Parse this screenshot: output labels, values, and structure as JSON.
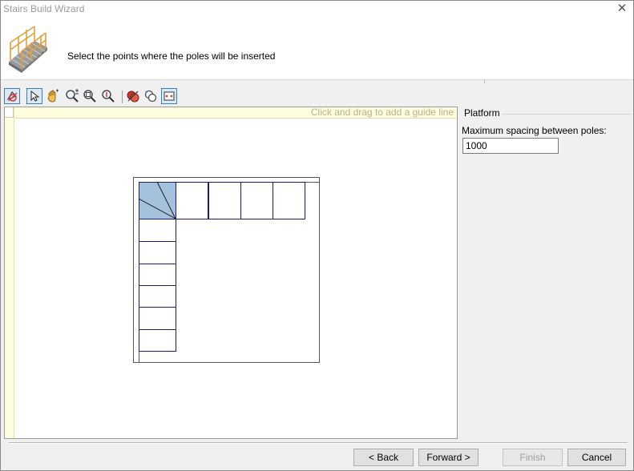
{
  "window": {
    "title": "Stairs Build Wizard",
    "close_symbol": "✕"
  },
  "header": {
    "instruction": "Select the points where the poles will be inserted",
    "logo_icon": "stairs-logo-icon"
  },
  "toolbar": {
    "tools": [
      {
        "name": "shape-select-icon",
        "active": true
      },
      {
        "name": "pointer-icon",
        "active": true
      },
      {
        "name": "pan-hand-icon",
        "active": false
      },
      {
        "name": "zoom-plus-minus-icon",
        "active": false
      },
      {
        "name": "zoom-window-icon",
        "active": false
      },
      {
        "name": "zoom-extents-icon",
        "active": false
      },
      {
        "name": "remove-poles-icon",
        "active": false
      },
      {
        "name": "circles-icon",
        "active": false
      },
      {
        "name": "fit-to-view-icon",
        "active": true
      }
    ]
  },
  "canvas": {
    "guide_hint": "Click and drag to add a guide line",
    "colors": {
      "outline": "#545454",
      "steps": "#1f1d6b",
      "landing_fill": "#a5c2dd"
    }
  },
  "panel": {
    "group_title": "Platform",
    "spacing_label": "Maximum spacing between poles:",
    "spacing_value": "1000"
  },
  "buttons": {
    "back": "< Back",
    "forward": "Forward >",
    "finish": "Finish",
    "cancel": "Cancel"
  }
}
